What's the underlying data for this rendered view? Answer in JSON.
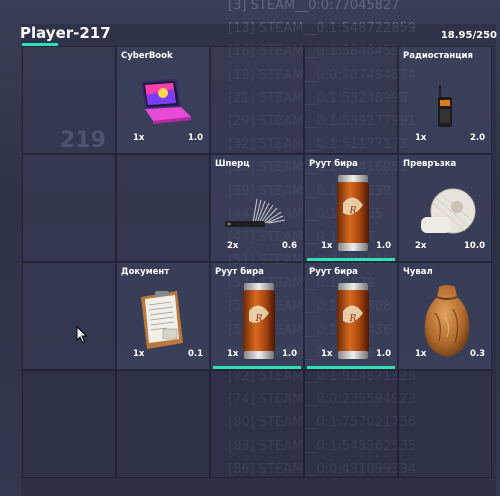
{
  "player": {
    "name": "Player-217",
    "weight": "18.95/250"
  },
  "background_slot_number": "219",
  "console_lines": [
    "[3] STEAM__0:0:77045827",
    "[13] STEAM__0:1:548722859",
    "[16] STEAM__0:1:58484591",
    "[19] STEAM__0:0:707494874",
    "[21] STEAM__0:1:53248995",
    "[29] STEAM__0:1:539277991",
    "[32] STEAM__0:1:51177173",
    "[38] STEAM__0:1:31416053",
    "[39] STEAM__0:1:546539",
    "[44] STEAM__0:1:18085",
    "[47] STEAM__0:1:1347",
    "[51] STEAM__0:0:382519",
    "[52] STEAM__0:1:7129",
    "[55] STEAM__0:1:592808",
    "[57] STEAM__0:1:139436",
    "[69] STEAM__0:1:7438",
    "[72] STEAM__0:1:924871323",
    "[74] STEAM__0:0:235594923",
    "[80] STEAM__0:1:757021756",
    "[83] STEAM__0:1:543362535",
    "[86] STEAM__0:0:431099334"
  ],
  "items": [
    {
      "slot": 1,
      "name": "CyberBook",
      "qty": "1x",
      "weight": "1.0",
      "icon": "laptop-icon",
      "in_use": false
    },
    {
      "slot": 4,
      "name": "Радиостанция",
      "qty": "1x",
      "weight": "2.0",
      "icon": "radio-icon",
      "in_use": false
    },
    {
      "slot": 7,
      "name": "Шперц",
      "qty": "2x",
      "weight": "0.6",
      "icon": "lockpick-icon",
      "in_use": false
    },
    {
      "slot": 8,
      "name": "Руут бира",
      "qty": "1x",
      "weight": "1.0",
      "icon": "beer-can-icon",
      "in_use": true
    },
    {
      "slot": 9,
      "name": "Превръзка",
      "qty": "2x",
      "weight": "10.0",
      "icon": "bandage-icon",
      "in_use": false
    },
    {
      "slot": 11,
      "name": "Документ",
      "qty": "1x",
      "weight": "0.1",
      "icon": "document-icon",
      "in_use": false
    },
    {
      "slot": 12,
      "name": "Руут бира",
      "qty": "1x",
      "weight": "1.0",
      "icon": "beer-can-icon",
      "in_use": true
    },
    {
      "slot": 13,
      "name": "Руут бира",
      "qty": "1x",
      "weight": "1.0",
      "icon": "beer-can-icon",
      "in_use": true
    },
    {
      "slot": 14,
      "name": "Чувал",
      "qty": "1x",
      "weight": "0.3",
      "icon": "sack-icon",
      "in_use": false
    }
  ],
  "colors": {
    "accent": "#2ee0b8"
  }
}
